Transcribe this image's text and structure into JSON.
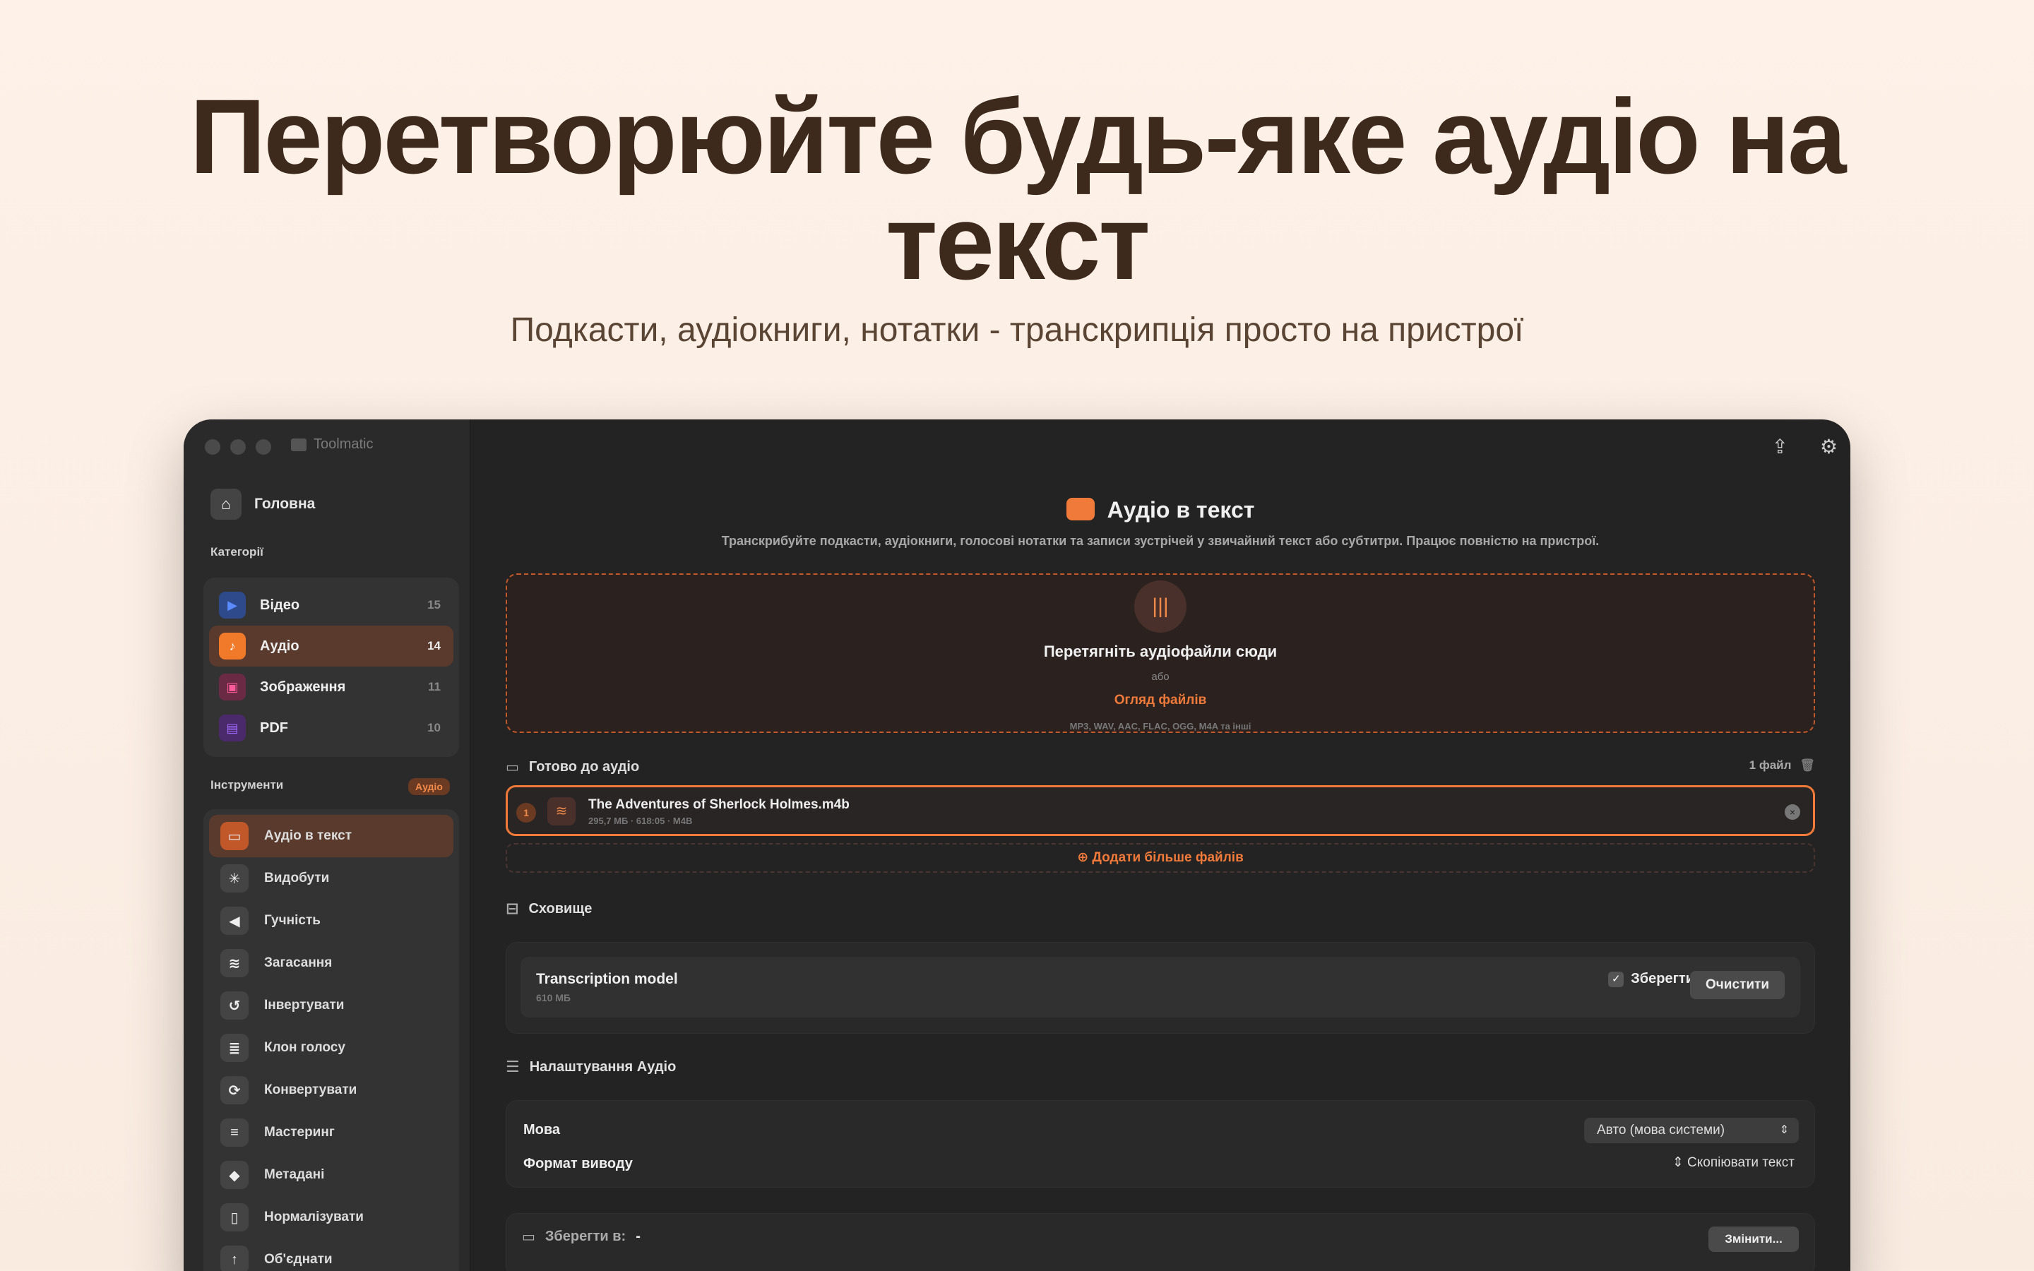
{
  "hero": {
    "title": "Перетворюйте будь-яке аудіо на текст",
    "subtitle": "Подкасти, аудіокниги, нотатки - транскрипція просто на пристрої"
  },
  "app": {
    "name": "Toolmatic"
  },
  "sidebar": {
    "home": "Головна",
    "categories_label": "Категорії",
    "categories": [
      {
        "label": "Відео",
        "count": "15",
        "color": "#2e5fd6"
      },
      {
        "label": "Аудіо",
        "count": "14",
        "color": "#f07a2a"
      },
      {
        "label": "Зображення",
        "count": "11",
        "color": "#d0336a"
      },
      {
        "label": "PDF",
        "count": "10",
        "color": "#7a3ac0"
      }
    ],
    "tools_label": "Інструменти",
    "tools_badge": "Аудіо",
    "tools": [
      {
        "label": "Аудіо в текст",
        "icon": "chat-icon"
      },
      {
        "label": "Видобути",
        "icon": "sparkle-icon"
      },
      {
        "label": "Гучність",
        "icon": "speaker-icon"
      },
      {
        "label": "Загасання",
        "icon": "waveform-icon"
      },
      {
        "label": "Інвертувати",
        "icon": "undo-icon"
      },
      {
        "label": "Клон голосу",
        "icon": "voice-icon"
      },
      {
        "label": "Конвертувати",
        "icon": "refresh-icon"
      },
      {
        "label": "Мастеринг",
        "icon": "mastering-icon"
      },
      {
        "label": "Метадані",
        "icon": "tag-icon"
      },
      {
        "label": "Нормалізувати",
        "icon": "normalize-icon"
      },
      {
        "label": "Об'єднати",
        "icon": "merge-icon"
      }
    ]
  },
  "main": {
    "title": "Аудіо в текст",
    "description": "Транскрибуйте подкасти, аудіокниги, голосові нотатки та записи зустрічей у звичайний текст або субтитри. Працює повністю на пристрої.",
    "drop": {
      "title": "Перетягніть аудіофайли сюди",
      "or": "або",
      "browse": "Огляд файлів",
      "formats": "MP3, WAV, AAC, FLAC, OGG, M4A та інші"
    },
    "ready_label": "Готово до аудіо",
    "ready_count": "1 файл",
    "file": {
      "index": "1",
      "name": "The Adventures of Sherlock Holmes.m4b",
      "meta": "295,7 МБ · 618:05 · M4B"
    },
    "add_more": "Додати більше файлів",
    "storage_label": "Сховище",
    "storage": {
      "model": "Transcription model",
      "size": "610 МБ",
      "keep": "Зберегти",
      "clear": "Очистити"
    },
    "settings_label": "Налаштування Аудіо",
    "settings": {
      "language_label": "Мова",
      "language_value": "Авто (мова системи)",
      "format_label": "Формат виводу",
      "format_value": "Скопіювати текст"
    },
    "save_to": {
      "label": "Зберегти в:",
      "value": "-",
      "change": "Змінити..."
    }
  },
  "colors": {
    "accent": "#ef7a3a",
    "background": "#232323",
    "sidebar": "#2a2a2a"
  }
}
